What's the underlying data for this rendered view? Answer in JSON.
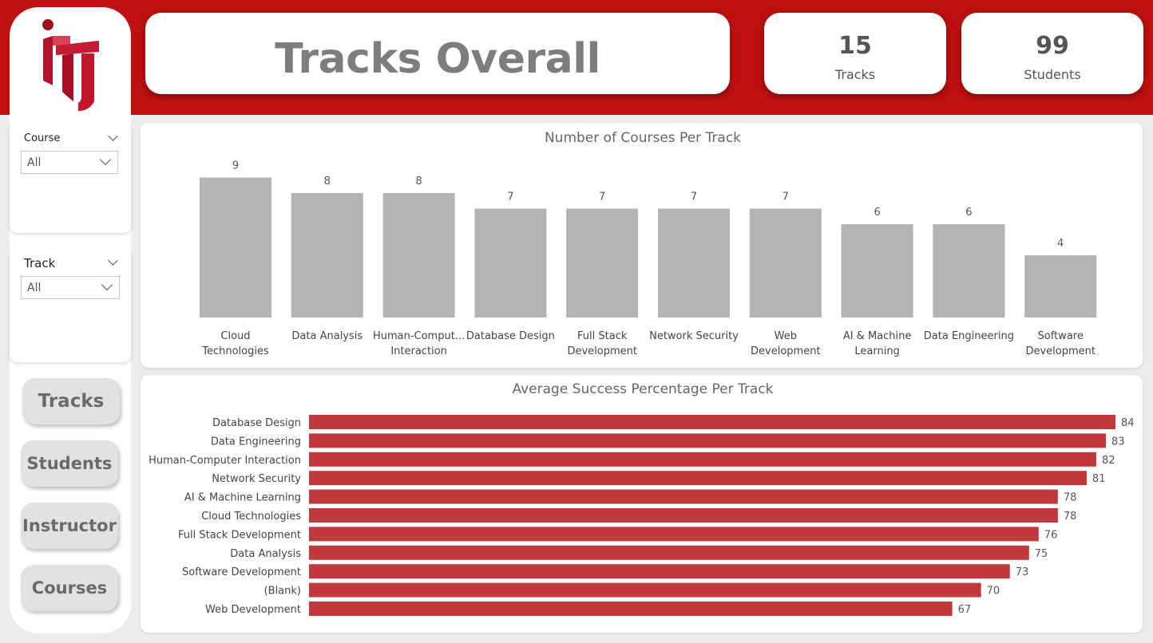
{
  "header": {
    "title": "Tracks Overall",
    "kpis": [
      {
        "value": "15",
        "label": "Tracks"
      },
      {
        "value": "99",
        "label": "Students"
      }
    ]
  },
  "filters": {
    "course": {
      "title": "Course",
      "value": "All"
    },
    "track": {
      "title": "Track",
      "value": "All"
    }
  },
  "nav": {
    "tracks": "Tracks",
    "students": "Students",
    "instructor": "Instructor",
    "courses": "Courses"
  },
  "colors": {
    "brand_red": "#bd1010",
    "bar_gray": "#b3b3b3",
    "bar_red": "#c0393b"
  },
  "chart_data": [
    {
      "type": "bar",
      "title": "Number of Courses Per Track",
      "categories": [
        [
          "Cloud",
          "Technologies"
        ],
        [
          "Data Analysis"
        ],
        [
          "Human-Comput...",
          "Interaction"
        ],
        [
          "Database Design"
        ],
        [
          "Full Stack",
          "Development"
        ],
        [
          "Network Security"
        ],
        [
          "Web",
          "Development"
        ],
        [
          "AI & Machine",
          "Learning"
        ],
        [
          "Data Engineering"
        ],
        [
          "Software",
          "Development"
        ]
      ],
      "values": [
        9,
        8,
        8,
        7,
        7,
        7,
        7,
        6,
        6,
        4
      ],
      "ylim": [
        0,
        10
      ],
      "grid": false
    },
    {
      "type": "bar",
      "orientation": "horizontal",
      "title": "Average Success Percentage Per Track",
      "categories": [
        "Database Design",
        "Data Engineering",
        "Human-Computer Interaction",
        "Network Security",
        "AI & Machine Learning",
        "Cloud Technologies",
        "Full Stack Development",
        "Data Analysis",
        "Software Development",
        "(Blank)",
        "Web Development"
      ],
      "values": [
        84,
        83,
        82,
        81,
        78,
        78,
        76,
        75,
        73,
        70,
        67
      ],
      "xlim": [
        0,
        84
      ],
      "grid": false
    }
  ]
}
